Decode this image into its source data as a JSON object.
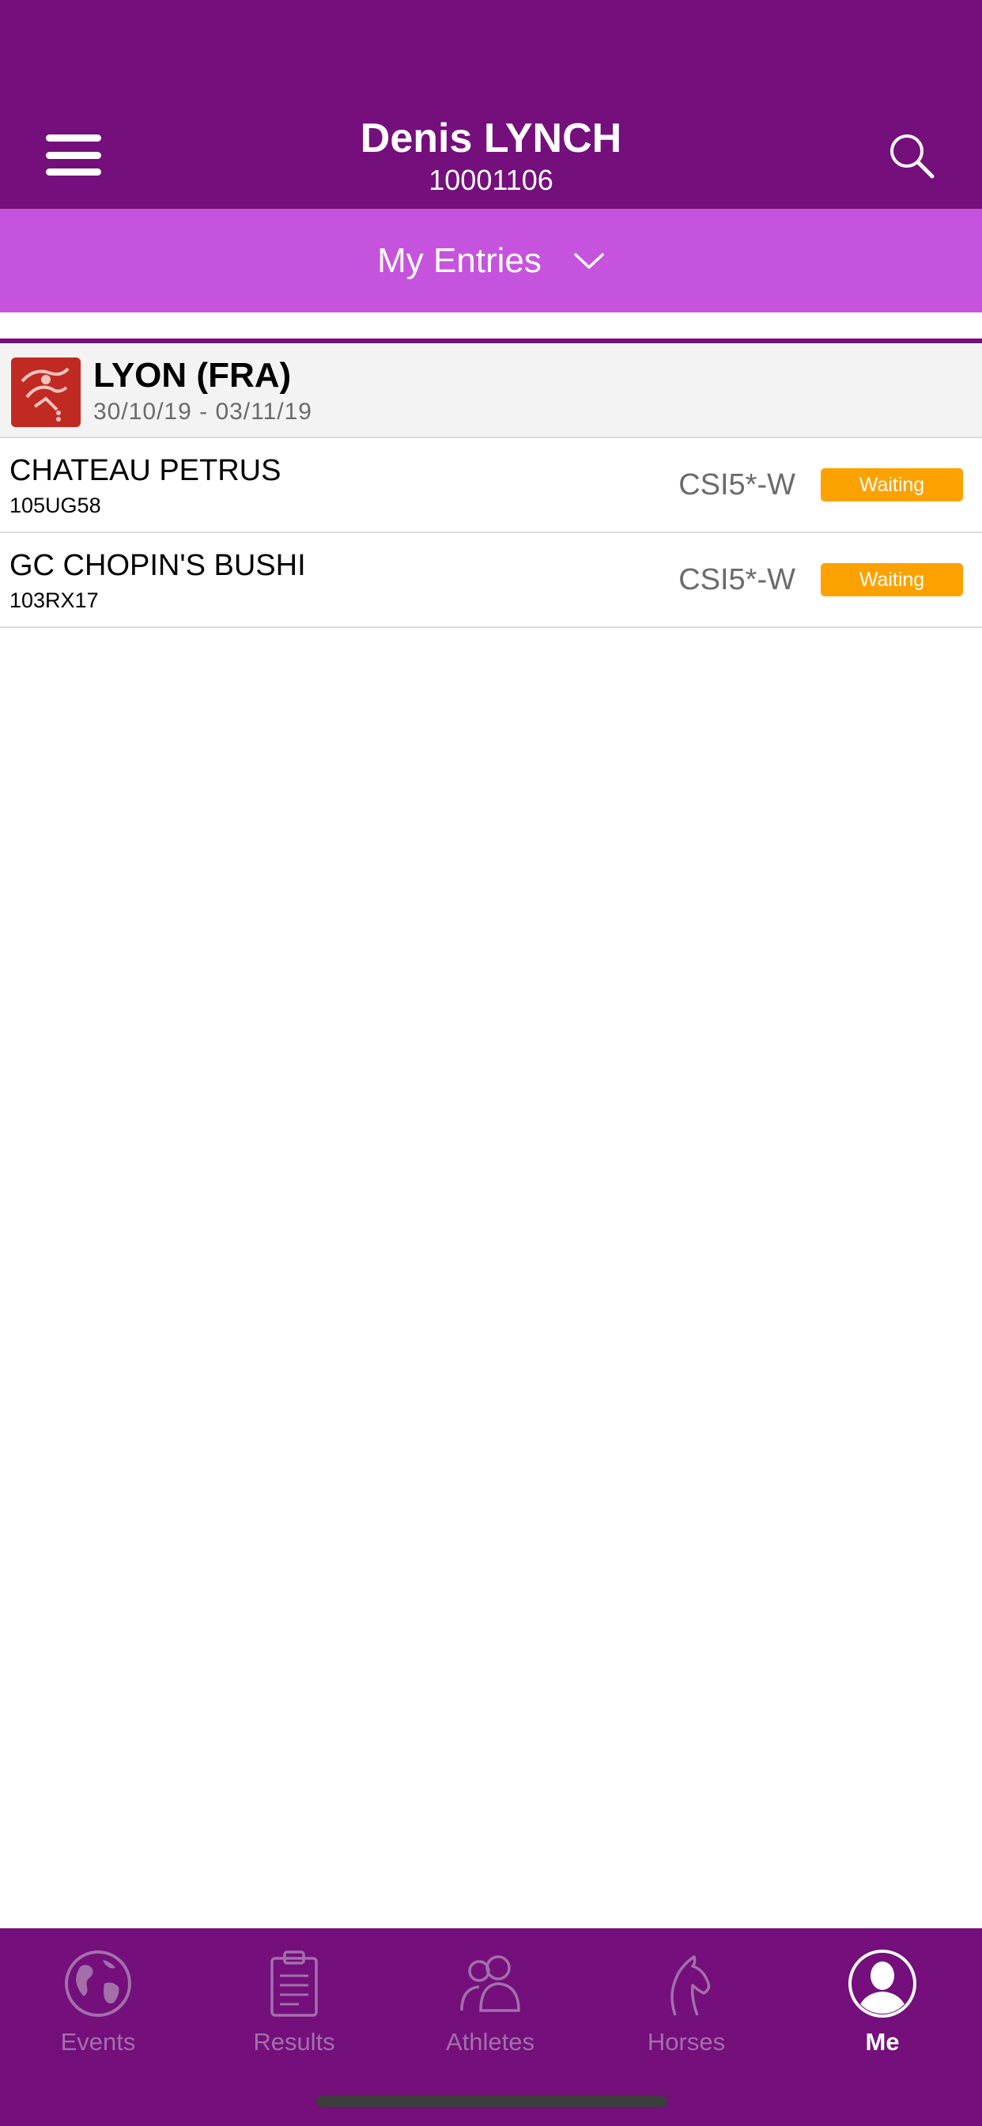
{
  "header": {
    "title": "Denis LYNCH",
    "subtitle": "10001106",
    "menu_icon": "hamburger-menu-icon",
    "search_icon": "search-icon"
  },
  "dropdown": {
    "label": "My Entries",
    "icon": "chevron-down-icon"
  },
  "event": {
    "title": "LYON (FRA)",
    "dates": "30/10/19 - 03/11/19",
    "logo_icon": "show-jumping-logo-icon"
  },
  "entries": [
    {
      "name": "CHATEAU PETRUS",
      "id": "105UG58",
      "class": "CSI5*-W",
      "status": "Waiting"
    },
    {
      "name": "GC CHOPIN'S BUSHI",
      "id": "103RX17",
      "class": "CSI5*-W",
      "status": "Waiting"
    }
  ],
  "tabs": [
    {
      "label": "Events",
      "icon": "globe-icon",
      "active": false
    },
    {
      "label": "Results",
      "icon": "clipboard-icon",
      "active": false
    },
    {
      "label": "Athletes",
      "icon": "people-icon",
      "active": false
    },
    {
      "label": "Horses",
      "icon": "horse-head-icon",
      "active": false
    },
    {
      "label": "Me",
      "icon": "user-icon",
      "active": true
    }
  ],
  "colors": {
    "header": "#740f7b",
    "dropdown": "#c653dd",
    "status_waiting": "#fba201",
    "tab_inactive": "#a26fab",
    "tab_active": "#ffffff"
  }
}
